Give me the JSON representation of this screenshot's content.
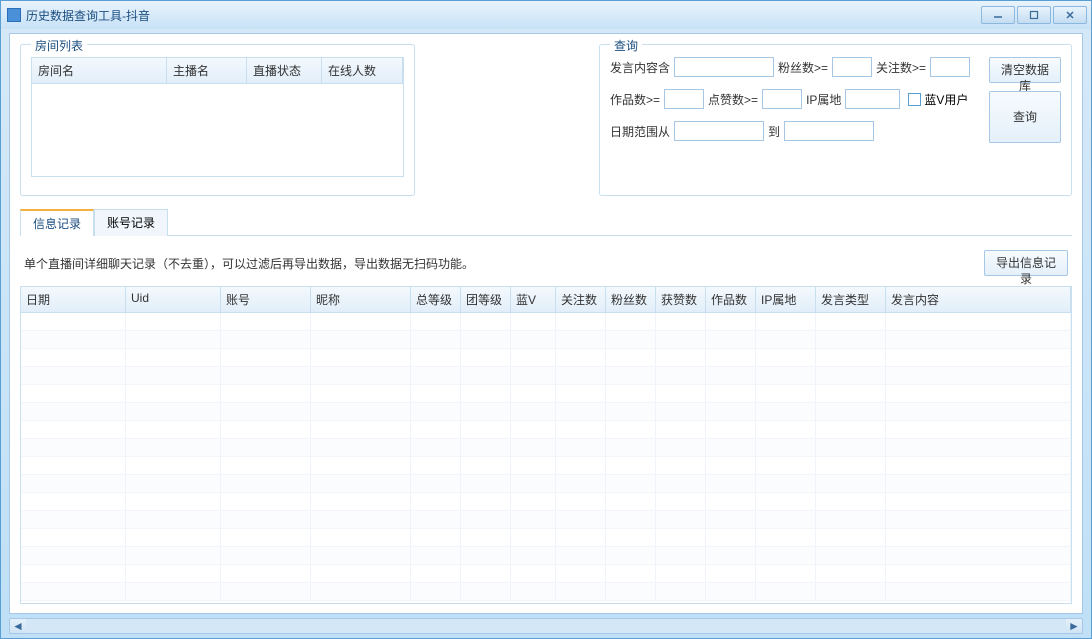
{
  "window": {
    "title": "历史数据查询工具-抖音"
  },
  "roomlist": {
    "groupTitle": "房间列表",
    "headers": [
      "房间名",
      "主播名",
      "直播状态",
      "在线人数"
    ]
  },
  "query": {
    "groupTitle": "查询",
    "labels": {
      "speechContains": "发言内容含",
      "fansGte": "粉丝数>=",
      "followGte": "关注数>=",
      "worksGte": "作品数>=",
      "likesGte": "点赞数>=",
      "ipLocation": "IP属地",
      "blueV": "蓝V用户",
      "dateFrom": "日期范围从",
      "dateTo": "到"
    },
    "values": {
      "speechContains": "",
      "fansGte": "",
      "followGte": "",
      "worksGte": "",
      "likesGte": "",
      "ipLocation": "",
      "blueVChecked": false,
      "dateFrom": "",
      "dateTo": ""
    },
    "buttons": {
      "clearDb": "清空数据库",
      "query": "查询"
    }
  },
  "tabs": {
    "items": [
      "信息记录",
      "账号记录"
    ],
    "activeIndex": 0
  },
  "infoTab": {
    "description": "单个直播间详细聊天记录（不去重），可以过滤后再导出数据，导出数据无扫码功能。",
    "exportBtn": "导出信息记录",
    "columns": [
      "日期",
      "Uid",
      "账号",
      "昵称",
      "总等级",
      "团等级",
      "蓝V",
      "关注数",
      "粉丝数",
      "获赞数",
      "作品数",
      "IP属地",
      "发言类型",
      "发言内容"
    ]
  }
}
